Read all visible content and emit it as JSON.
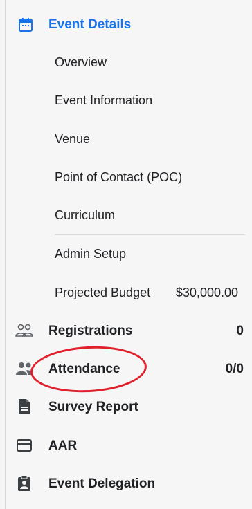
{
  "header": {
    "label": "Event Details",
    "icon": "calendar-icon",
    "accent": "#1a73e8"
  },
  "sub_items": [
    {
      "label": "Overview"
    },
    {
      "label": "Event Information"
    },
    {
      "label": "Venue"
    },
    {
      "label": "Point of Contact (POC)"
    },
    {
      "label": "Curriculum"
    },
    {
      "label": "Admin Setup"
    },
    {
      "label": "Projected Budget",
      "value": "$30,000.00"
    }
  ],
  "main_items": [
    {
      "label": "Registrations",
      "icon": "people-outline-icon",
      "count": "0"
    },
    {
      "label": "Attendance",
      "icon": "people-filled-icon",
      "count": "0/0"
    },
    {
      "label": "Survey Report",
      "icon": "document-icon"
    },
    {
      "label": "AAR",
      "icon": "card-icon"
    },
    {
      "label": "Event Delegation",
      "icon": "clipboard-person-icon"
    }
  ],
  "annotation": {
    "color": "#e0202b",
    "target": "Attendance"
  }
}
